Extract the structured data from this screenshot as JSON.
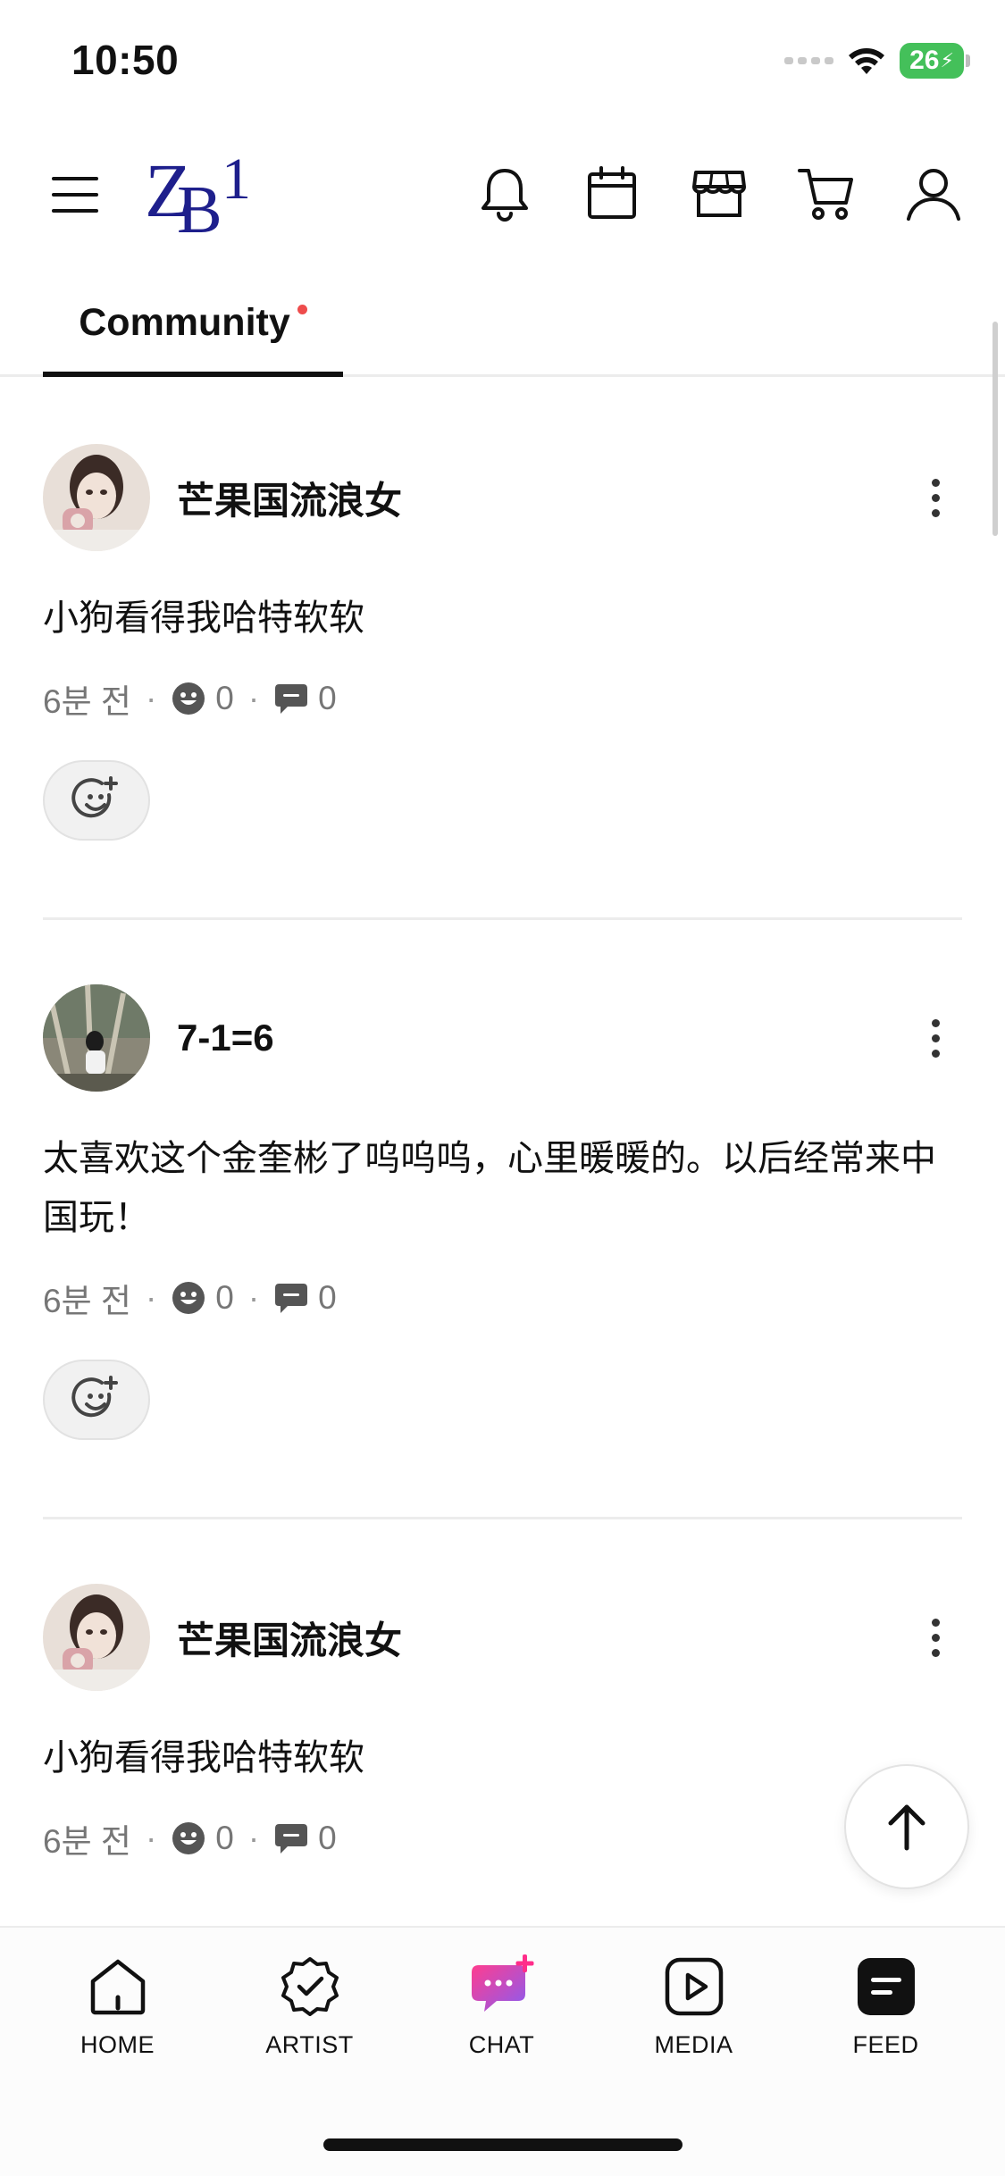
{
  "status_bar": {
    "time": "10:50",
    "battery": "26"
  },
  "header": {
    "logo_text": "ZB1",
    "icons": [
      "menu-icon",
      "bell-icon",
      "calendar-icon",
      "store-icon",
      "cart-icon",
      "profile-icon"
    ]
  },
  "tabs": {
    "community_label": "Community"
  },
  "posts": [
    {
      "username": "芒果国流浪女",
      "body": "小狗看得我哈特软软",
      "time": "6분 전",
      "reactions": "0",
      "comments": "0"
    },
    {
      "username": "7-1=6",
      "body": "太喜欢这个金奎彬了呜呜呜，心里暖暖的。以后经常来中国玩！",
      "time": "6분 전",
      "reactions": "0",
      "comments": "0"
    },
    {
      "username": "芒果国流浪女",
      "body": "小狗看得我哈特软软",
      "time": "6분 전",
      "reactions": "0",
      "comments": "0"
    }
  ],
  "bottom_nav": {
    "home": "HOME",
    "artist": "ARTIST",
    "chat": "CHAT",
    "media": "MEDIA",
    "feed": "FEED"
  },
  "colors": {
    "accent": "#ee4c4c",
    "logo": "#1e1f8c",
    "chat_pink": "#ff2d8a",
    "battery": "#44c05a"
  }
}
